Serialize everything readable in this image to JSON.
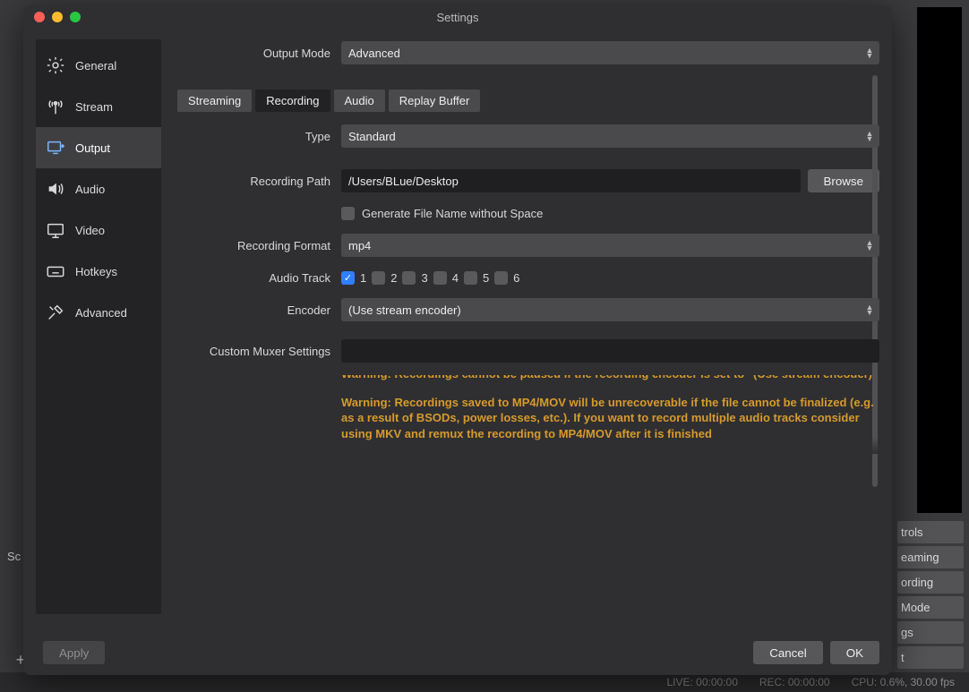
{
  "window": {
    "title": "Settings"
  },
  "sidebar": {
    "items": [
      {
        "label": "General"
      },
      {
        "label": "Stream"
      },
      {
        "label": "Output"
      },
      {
        "label": "Audio"
      },
      {
        "label": "Video"
      },
      {
        "label": "Hotkeys"
      },
      {
        "label": "Advanced"
      }
    ],
    "selected_index": 2
  },
  "output_mode": {
    "label": "Output Mode",
    "value": "Advanced"
  },
  "tabs": {
    "items": [
      "Streaming",
      "Recording",
      "Audio",
      "Replay Buffer"
    ],
    "active_index": 1
  },
  "recording": {
    "type": {
      "label": "Type",
      "value": "Standard"
    },
    "path": {
      "label": "Recording Path",
      "value": "/Users/BLue/Desktop",
      "browse": "Browse"
    },
    "no_space": {
      "label": "Generate File Name without Space",
      "checked": false
    },
    "format": {
      "label": "Recording Format",
      "value": "mp4"
    },
    "audio_track": {
      "label": "Audio Track",
      "tracks": [
        {
          "n": "1",
          "checked": true
        },
        {
          "n": "2",
          "checked": false
        },
        {
          "n": "3",
          "checked": false
        },
        {
          "n": "4",
          "checked": false
        },
        {
          "n": "5",
          "checked": false
        },
        {
          "n": "6",
          "checked": false
        }
      ]
    },
    "encoder": {
      "label": "Encoder",
      "value": "(Use stream encoder)"
    },
    "muxer": {
      "label": "Custom Muxer Settings",
      "value": ""
    }
  },
  "warnings": {
    "w1": "Warning: Recordings cannot be paused if the recording encoder is set to \"(Use stream encoder)\"",
    "w2": "Warning: Recordings saved to MP4/MOV will be unrecoverable if the file cannot be finalized (e.g. as a result of BSODs, power losses, etc.). If you want to record multiple audio tracks consider using MKV and remux the recording to MP4/MOV after it is finished"
  },
  "footer": {
    "apply": "Apply",
    "cancel": "Cancel",
    "ok": "OK"
  },
  "background": {
    "sc_label": "Sc",
    "right": [
      "trols",
      "eaming",
      "ording",
      "Mode",
      "gs",
      "t"
    ],
    "status": {
      "live": "LIVE: 00:00:00",
      "rec": "REC: 00:00:00",
      "cpu": "CPU: 0.6%, 30.00 fps"
    }
  }
}
